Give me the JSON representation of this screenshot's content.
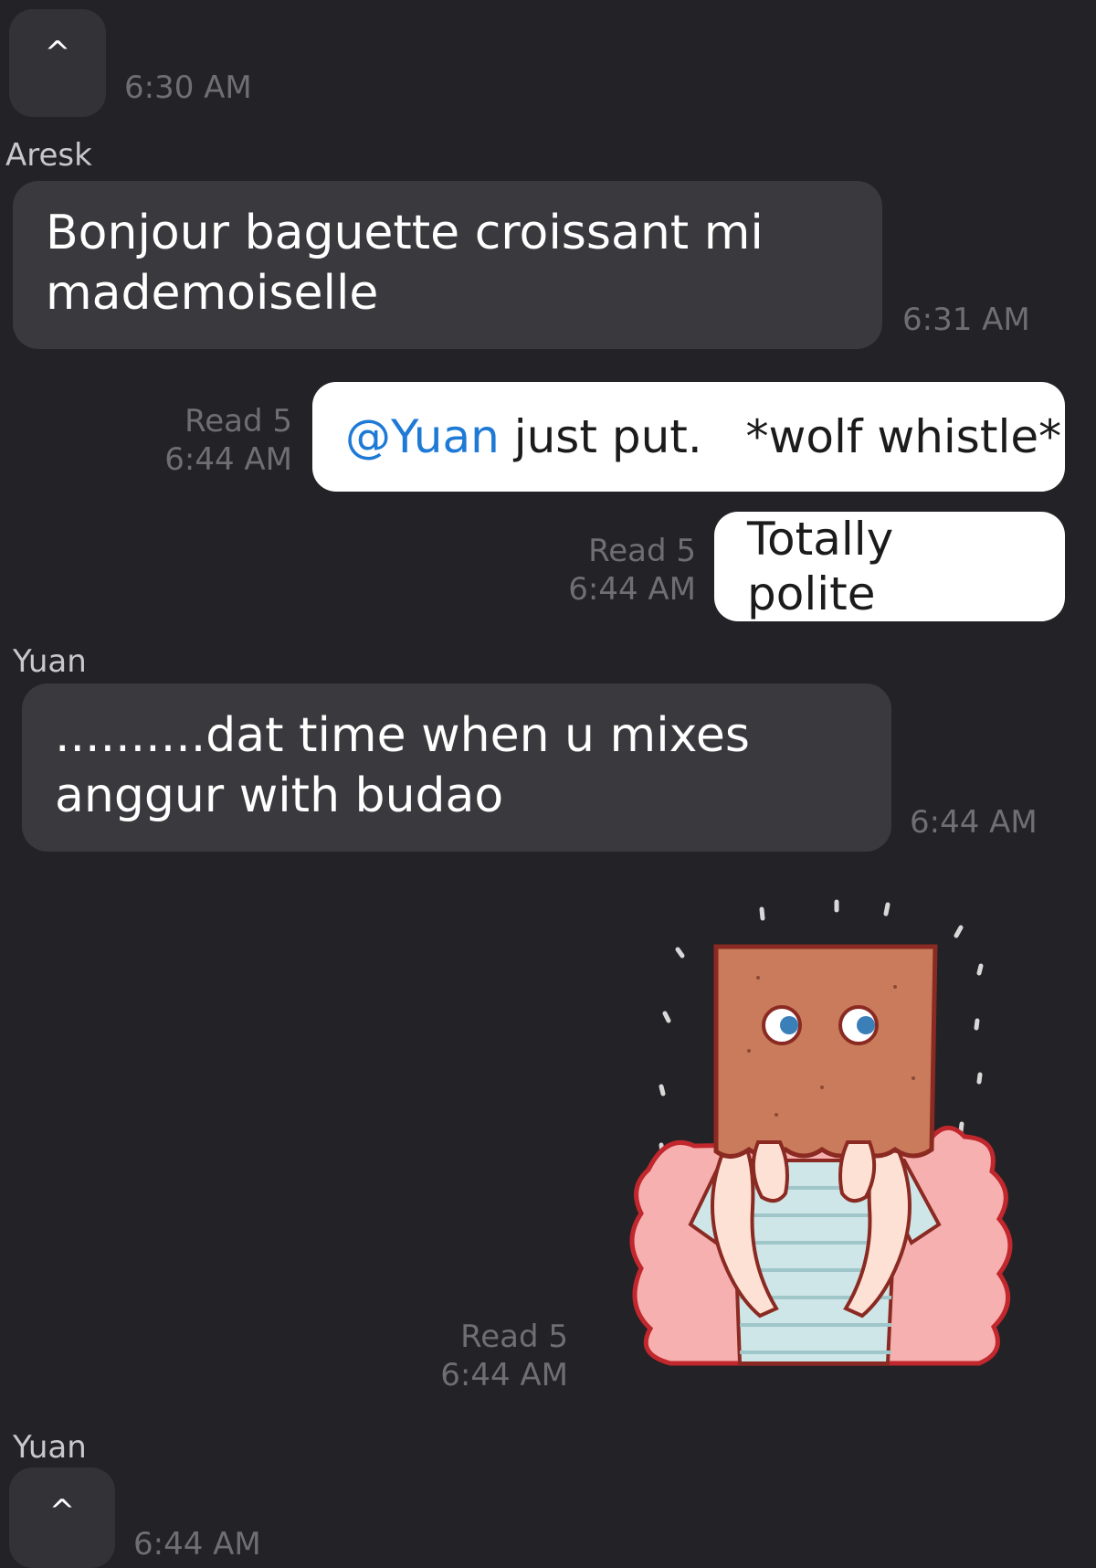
{
  "messages": {
    "m1": {
      "expand_glyph": "^",
      "time": "6:30 AM"
    },
    "m2": {
      "sender": "Aresk",
      "text": "Bonjour baguette croissant mi mademoiselle",
      "time": "6:31 AM"
    },
    "m3": {
      "mention": "@Yuan",
      "text": " just put.   *wolf whistle*",
      "read": "Read 5",
      "time": "6:44 AM"
    },
    "m4": {
      "text": "Totally polite",
      "read": "Read 5",
      "time": "6:44 AM"
    },
    "m5": {
      "sender": "Yuan",
      "text": "..........dat time when u mixes anggur with budao",
      "time": "6:44 AM"
    },
    "m6": {
      "sticker_icon": "paper-bag-head-sticker",
      "read": "Read 5",
      "time": "6:44 AM"
    },
    "m7": {
      "sender": "Yuan",
      "expand_glyph": "^",
      "time": "6:44 AM"
    }
  },
  "colors": {
    "background": "#232226",
    "incoming_bubble": "#3a393d",
    "outgoing_bubble": "#ffffff",
    "mention": "#1f7ad6",
    "meta_text": "#6f6e73"
  }
}
